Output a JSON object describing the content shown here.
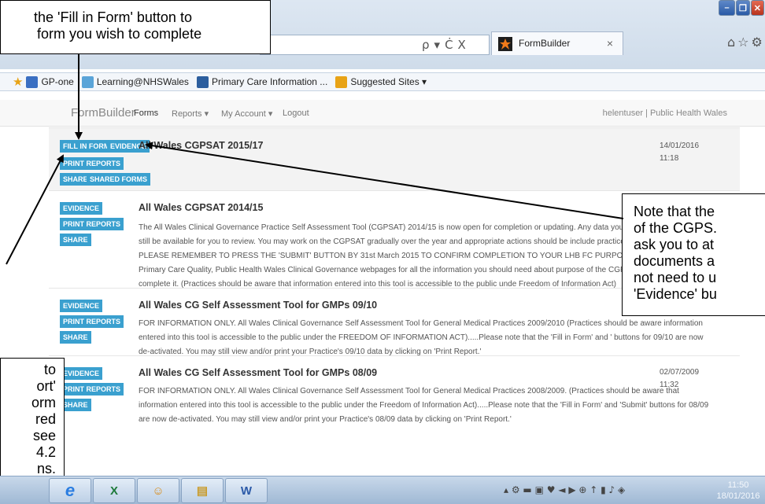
{
  "browser": {
    "tab_title": "FormBuilder",
    "tab_close": "×",
    "addr_tools": [
      "ρ",
      "▾",
      "Ċ",
      "X"
    ],
    "home_icons": "⌂☆⚙",
    "window_buttons": {
      "minimize": "–",
      "maximize": "❐",
      "close": "✕"
    }
  },
  "favorites": {
    "star": "★",
    "items": [
      {
        "label": "GP-one",
        "icon_color": "#3a6fc2"
      },
      {
        "label": "Learning@NHSWales",
        "icon_color": "#5aa4d8"
      },
      {
        "label": "Primary Care Information ...",
        "icon_color": "#2c5e9e"
      },
      {
        "label": "Suggested Sites ▾",
        "icon_color": "#e8a316"
      }
    ]
  },
  "navbar": {
    "brand": "FormBuilder",
    "links": [
      "Forms",
      "Reports ▾",
      "My Account ▾",
      "Logout"
    ],
    "user": "helentuser | Public Health Wales"
  },
  "forms": [
    {
      "title": "All Wales CGPSAT 2015/17",
      "date": "14/01/2016",
      "time": "11:18",
      "buttons": [
        "FILL IN FORM",
        "EVIDENCE",
        "PRINT REPORTS",
        "SHARE",
        "SHARED FORMS"
      ],
      "description": ""
    },
    {
      "title": "All Wales CGPSAT 2014/15",
      "date": "",
      "time": "",
      "buttons": [
        "EVIDENCE",
        "PRINT REPORTS",
        "SHARE"
      ],
      "description": "The All Wales Clinical Governance Practice Self Assessment Tool (CGPSAT) 2014/15 is now open for completion or updating. Any data you have ent since 2010 will still be available for you to review. You may work on the CGPSAT gradually over the year and appropriate actions should be include practice development plan. PLEASE REMEMBER TO PRESS THE 'SUBMIT' BUTTON BY 31st March 2015 TO CONFIRM COMPLETION TO YOUR LHB FC PURPOSES. Please see the Primary Care Quality, Public Health Wales Clinical Governance webpages for all the information you should need about purpose of the CGPSAT and how to complete it. (Practices should be aware that information entered into this tool is accessible to the public unde Freedom of Information Act)"
    },
    {
      "title": "All Wales CG Self Assessment Tool for GMPs 09/10",
      "date": "",
      "time": "",
      "buttons": [
        "EVIDENCE",
        "PRINT REPORTS",
        "SHARE"
      ],
      "description": "FOR INFORMATION ONLY. All Wales Clinical Governance Self Assessment Tool for General Medical Practices 2009/2010 (Practices should be aware information entered into this tool is accessible to the public under the FREEDOM OF INFORMATION ACT).....Please note that the 'Fill in Form' and ' buttons for 09/10 are now de-activated. You may still view and/or print your Practice's 09/10 data by clicking on 'Print Report.'"
    },
    {
      "title": "All Wales CG Self Assessment Tool for GMPs 08/09",
      "date": "02/07/2009",
      "time": "11:32",
      "buttons": [
        "EVIDENCE",
        "PRINT REPORTS",
        "SHARE"
      ],
      "description": "FOR INFORMATION ONLY. All Wales Clinical Governance Self Assessment Tool for General Medical Practices 2008/2009. (Practices should be aware that information entered into this tool is accessible to the public under the Freedom of Information Act).....Please note that the 'Fill in Form' and 'Submit' buttons for 08/09 are now de-activated. You may still view and/or print your Practice's 08/09 data by clicking on 'Print Report.'"
    }
  ],
  "callouts": {
    "top": [
      "the 'Fill in Form' button to",
      "form you wish to complete"
    ],
    "right": [
      "Note that the",
      "of the CGPS.",
      "ask you to at",
      "documents a",
      "not need to u",
      "'Evidence' bu"
    ],
    "left": [
      "to",
      "ort'",
      "orm",
      "red",
      "see",
      "4.2",
      "ns."
    ]
  },
  "taskbar": {
    "apps": [
      "e",
      "X",
      "☺",
      "▤",
      "W"
    ],
    "tray": "▴ ⚙ ▬ ▣ ♥ ◄ ▶ ⊕ ↑ ▮ ♪ ◈",
    "time": "11:50",
    "date": "18/01/2016"
  }
}
